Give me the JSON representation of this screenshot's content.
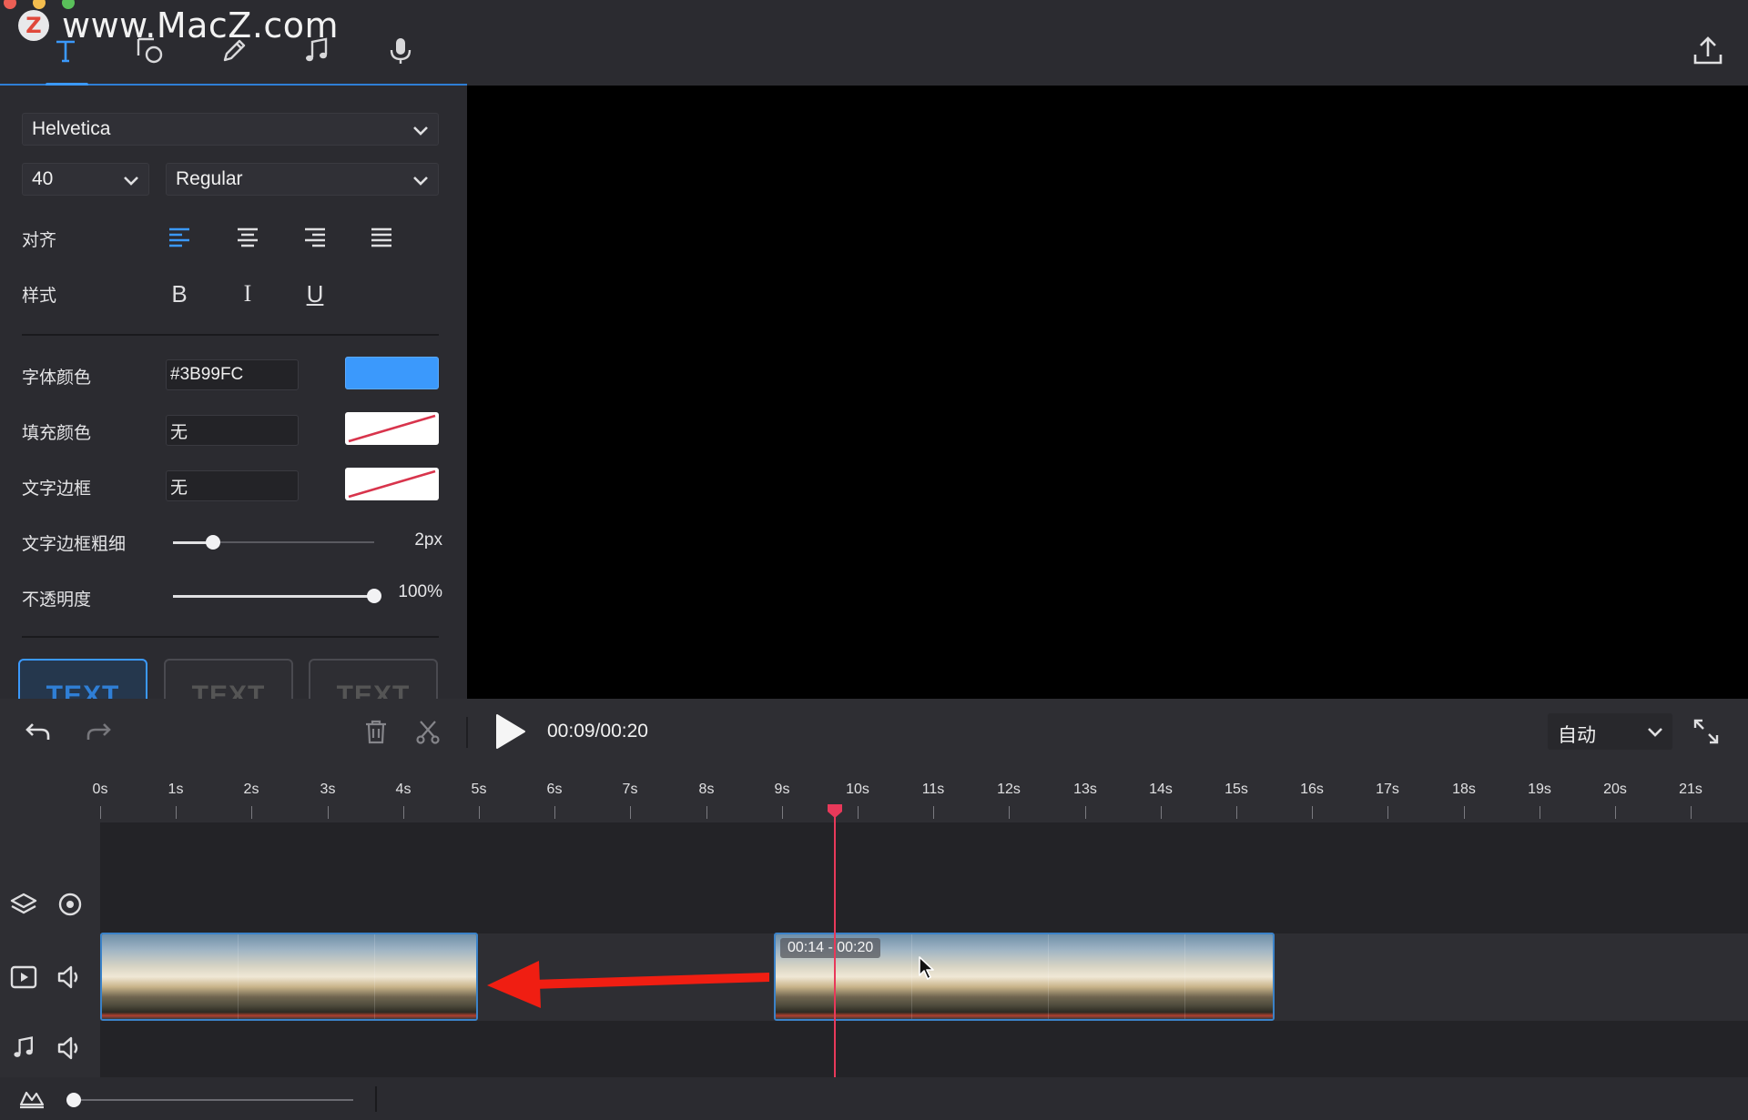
{
  "watermark": {
    "logo_letter": "Z",
    "text": "www.MacZ.com"
  },
  "toolbar": {
    "tools": [
      {
        "name": "text-tool",
        "icon": "text-icon"
      },
      {
        "name": "shape-tool",
        "icon": "shapes-icon"
      },
      {
        "name": "draw-tool",
        "icon": "pencil-icon"
      },
      {
        "name": "music-tool",
        "icon": "music-note-icon"
      },
      {
        "name": "record-tool",
        "icon": "microphone-icon"
      }
    ],
    "export_icon": "upload-icon"
  },
  "text_panel": {
    "font_family": "Helvetica",
    "font_size": "40",
    "font_weight": "Regular",
    "align_label": "对齐",
    "style_label": "样式",
    "style_buttons": {
      "bold": "B",
      "italic": "I",
      "underline": "U"
    },
    "font_color_label": "字体颜色",
    "font_color_value": "#3B99FC",
    "fill_color_label": "填充颜色",
    "fill_color_value": "无",
    "stroke_label": "文字边框",
    "stroke_value": "无",
    "stroke_width_label": "文字边框粗细",
    "stroke_width_value": "2px",
    "stroke_width_fraction": 0.2,
    "opacity_label": "不透明度",
    "opacity_value": "100%",
    "opacity_fraction": 1.0,
    "presets": [
      "TEXT",
      "TEXT",
      "TEXT"
    ]
  },
  "colors": {
    "accent": "#3B99FC",
    "playhead": "#E8395A",
    "arrow": "#F01E12"
  },
  "timeline": {
    "time_display": "00:09/00:20",
    "zoom_value": "自动",
    "ruler_ticks": [
      "0s",
      "1s",
      "2s",
      "3s",
      "4s",
      "5s",
      "6s",
      "7s",
      "8s",
      "9s",
      "10s",
      "11s",
      "12s",
      "13s",
      "14s",
      "15s",
      "16s",
      "17s",
      "18s",
      "19s",
      "20s",
      "21s"
    ],
    "playhead_time_s": 9.7,
    "clips": [
      {
        "name": "clip-1",
        "badge": ""
      },
      {
        "name": "clip-2",
        "badge": "00:14 - 00:20"
      }
    ]
  }
}
